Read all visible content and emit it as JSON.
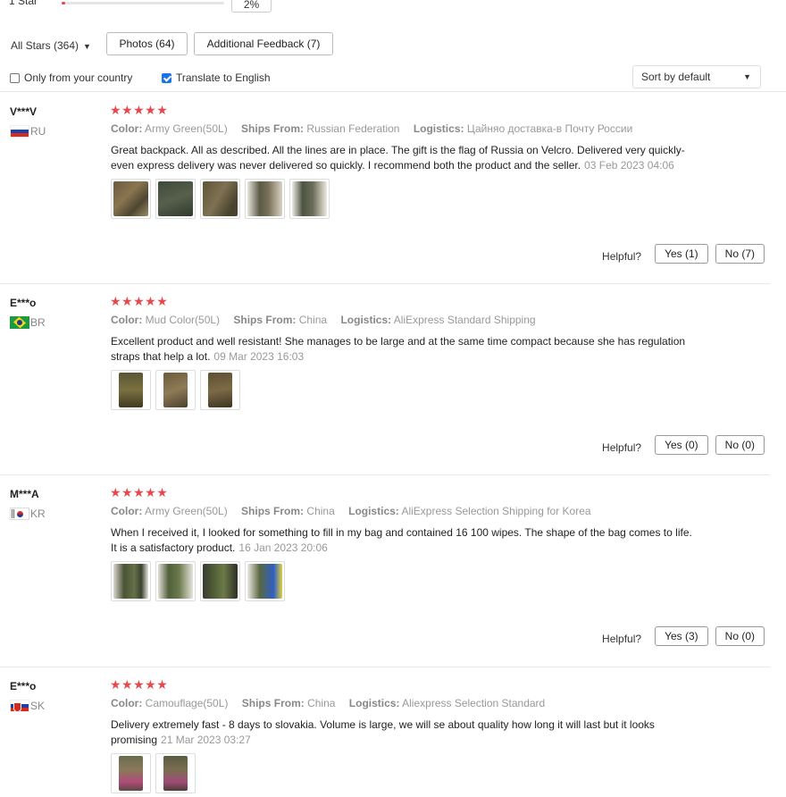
{
  "rating_row": {
    "label": "1 Star",
    "percent_text": "2%",
    "fill_fraction": 0.02,
    "fill_color": "#e5484d"
  },
  "filters": {
    "all_stars": "All Stars (364)",
    "photos": "Photos (64)",
    "additional_feedback": "Additional Feedback (7)"
  },
  "options": {
    "only_country": {
      "label": "Only from your country",
      "checked": false
    },
    "translate": {
      "label": "Translate to English",
      "checked": true
    },
    "sort": "Sort by default"
  },
  "labels": {
    "color": "Color:",
    "ships_from": "Ships From:",
    "logistics": "Logistics:",
    "helpful": "Helpful?"
  },
  "reviews": [
    {
      "name": "V***V",
      "country": "RU",
      "stars": "★★★★★",
      "color": "Army Green(50L)",
      "ships_from": "Russian Federation",
      "logistics": "Цайняо доставка-в Почту России",
      "text": "Great backpack. All as described. All the lines are in place. The gift is the flag of Russia on Velcro. Delivered very quickly- even express delivery was never delivered so quickly. I recommend both the product and the seller.",
      "date": "03 Feb 2023 04:06",
      "yes": "Yes (1)",
      "no": "No (7)"
    },
    {
      "name": "E***o",
      "country": "BR",
      "stars": "★★★★★",
      "color": "Mud Color(50L)",
      "ships_from": "China",
      "logistics": "AliExpress Standard Shipping",
      "text": "Excellent product and well resistant! She manages to be large and at the same time compact because she has regulation straps that help a lot.",
      "date": "09 Mar 2023 16:03",
      "yes": "Yes (0)",
      "no": "No (0)"
    },
    {
      "name": "M***A",
      "country": "KR",
      "stars": "★★★★★",
      "color": "Army Green(50L)",
      "ships_from": "China",
      "logistics": "AliExpress Selection Shipping for Korea",
      "text": "When I received it, I looked for something to fill in my bag and contained 16 100 wipes. The shape of the bag comes to life. It is a satisfactory product.",
      "date": "16 Jan 2023 20:06",
      "yes": "Yes (3)",
      "no": "No (0)"
    },
    {
      "name": "E***o",
      "country": "SK",
      "stars": "★★★★★",
      "color": "Camouflage(50L)",
      "ships_from": "China",
      "logistics": "Aliexpress Selection Standard",
      "text": "Delivery extremely fast - 8 days to slovakia. Volume is large, we will se about quality how long it will last but it looks promising",
      "date": "21 Mar 2023 03:27"
    }
  ]
}
